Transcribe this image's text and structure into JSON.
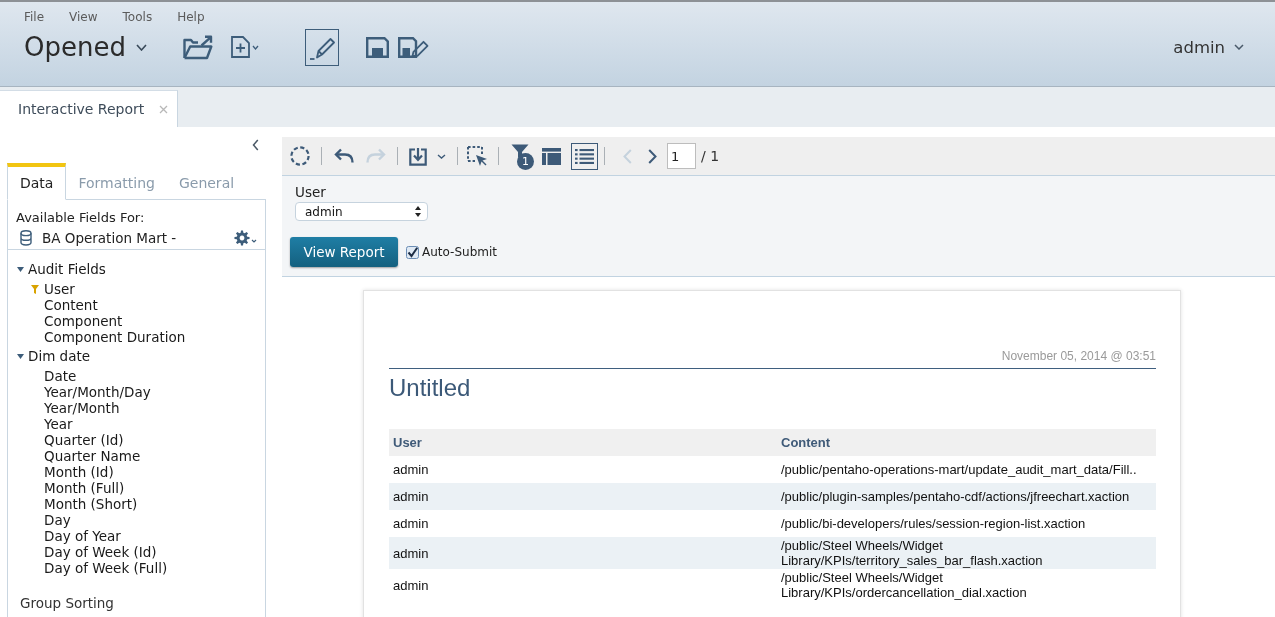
{
  "menu": [
    "File",
    "View",
    "Tools",
    "Help"
  ],
  "header": {
    "perspective": "Opened",
    "edit_mode": true,
    "user": "admin"
  },
  "document_tabs": [
    {
      "label": "Interactive Report",
      "selected": true
    }
  ],
  "side_panel": {
    "tabs": [
      {
        "label": "Data",
        "selected": true
      },
      {
        "label": "Formatting",
        "selected": false
      },
      {
        "label": "General",
        "selected": false
      }
    ],
    "fields_label": "Available Fields For:",
    "data_source": "BA Operation Mart -",
    "field_tree": [
      {
        "label": "Audit Fields",
        "expanded": true,
        "children": [
          {
            "label": "User",
            "filtered": true
          },
          {
            "label": "Content",
            "filtered": false
          },
          {
            "label": "Component",
            "filtered": false
          },
          {
            "label": "Component Duration",
            "filtered": false
          }
        ]
      },
      {
        "label": "Dim date",
        "expanded": true,
        "children": [
          {
            "label": "Date",
            "filtered": false
          },
          {
            "label": "Year/Month/Day",
            "filtered": false
          },
          {
            "label": "Year/Month",
            "filtered": false
          },
          {
            "label": "Year",
            "filtered": false
          },
          {
            "label": "Quarter (Id)",
            "filtered": false
          },
          {
            "label": "Quarter Name",
            "filtered": false
          },
          {
            "label": "Month (Id)",
            "filtered": false
          },
          {
            "label": "Month (Full)",
            "filtered": false
          },
          {
            "label": "Month (Short)",
            "filtered": false
          },
          {
            "label": "Day",
            "filtered": false
          },
          {
            "label": "Day of Year",
            "filtered": false
          },
          {
            "label": "Day of Week (Id)",
            "filtered": false
          },
          {
            "label": "Day of Week (Full)",
            "filtered": false
          }
        ]
      }
    ],
    "footer": "Group Sorting"
  },
  "toolbar": {
    "undo": {
      "disabled": false
    },
    "redo": {
      "disabled": true
    },
    "filter_count": "1",
    "layout_panel": {
      "on": false
    },
    "prompt_panel": {
      "on": true
    },
    "pager": {
      "previous": {
        "disabled": true
      },
      "next": {
        "disabled": false
      },
      "page": "1",
      "total": "/ 1"
    }
  },
  "prompt": {
    "label": "User",
    "value": "admin",
    "submit": "View Report",
    "auto_submit": {
      "label": "Auto-Submit",
      "checked": true
    }
  },
  "report": {
    "date": "November 05, 2014 @ 03:51",
    "title": "Untitled",
    "table": {
      "columns": [
        "User",
        "Content"
      ],
      "rows": [
        [
          "admin",
          "/public/pentaho-operations-mart/update_audit_mart_data/Fill.."
        ],
        [
          "admin",
          "/public/plugin-samples/pentaho-cdf/actions/jfreechart.xaction"
        ],
        [
          "admin",
          "/public/bi-developers/rules/session-region-list.xaction"
        ],
        [
          "admin",
          "/public/Steel Wheels/Widget Library/KPIs/territory_sales_bar_flash.xaction"
        ],
        [
          "admin",
          "/public/Steel Wheels/Widget Library/KPIs/ordercancellation_dial.xaction"
        ]
      ]
    }
  }
}
